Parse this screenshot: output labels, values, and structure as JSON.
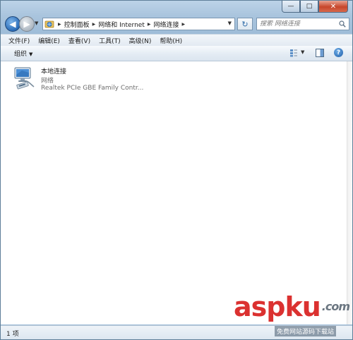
{
  "window": {
    "minimize_glyph": "—",
    "maximize_glyph": "□",
    "close_glyph": "✕"
  },
  "nav": {
    "address_crumbs": [
      "控制面板",
      "网络和 Internet",
      "网络连接"
    ],
    "search_placeholder": "搜索 网络连接"
  },
  "menu": {
    "items": [
      "文件(F)",
      "编辑(E)",
      "查看(V)",
      "工具(T)",
      "高级(N)",
      "帮助(H)"
    ]
  },
  "command_bar": {
    "organize_label": "组织",
    "help_glyph": "?"
  },
  "connection": {
    "name": "本地连接",
    "status": "网络",
    "device": "Realtek PCIe GBE Family Contr..."
  },
  "status_bar": {
    "item_count": "1 项"
  },
  "watermark": {
    "logo": "aspku",
    "tld": ".com",
    "tagline": "免费网站源码下载站"
  },
  "colors": {
    "frame": "#9ebcd8",
    "accent_blue": "#2a6cb8",
    "close_red": "#c7462b",
    "watermark_red": "#d8201f"
  },
  "icons": {
    "back": "back-arrow-icon",
    "forward": "forward-arrow-icon",
    "address": "network-folder-icon",
    "refresh": "refresh-icon",
    "search": "search-icon",
    "views": "change-view-icon",
    "preview": "preview-pane-icon",
    "help": "help-icon",
    "connection": "network-adapter-icon"
  }
}
